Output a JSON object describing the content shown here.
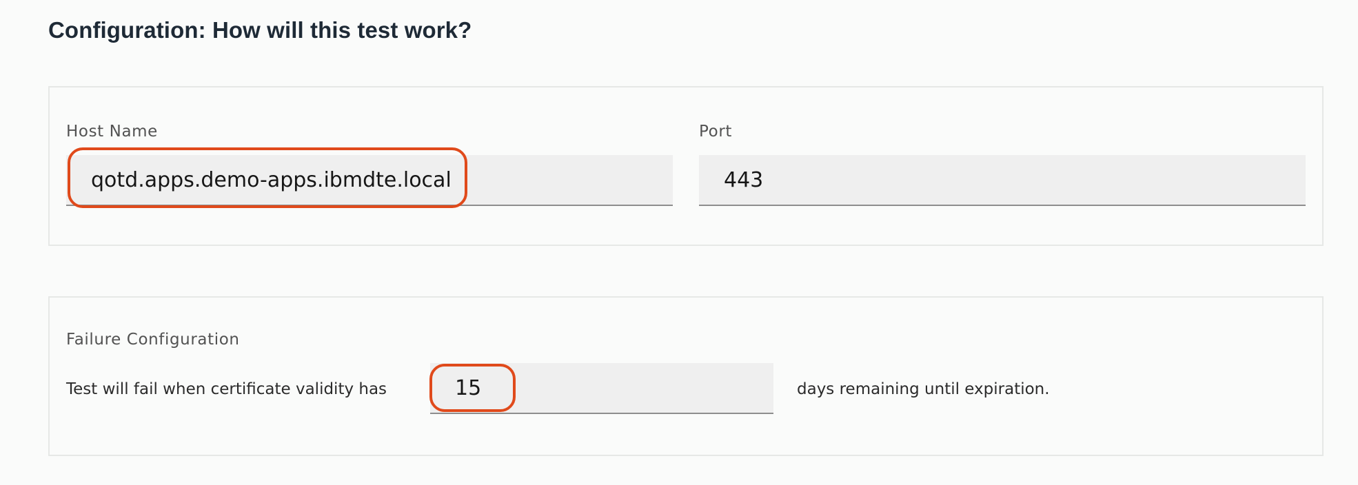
{
  "configuration": {
    "title": "Configuration: How will this test work?",
    "host_name": {
      "label": "Host Name",
      "value": "qotd.apps.demo-apps.ibmdte.local"
    },
    "port": {
      "label": "Port",
      "value": "443"
    },
    "failure": {
      "label": "Failure Configuration",
      "text_before": "Test will fail when certificate validity has",
      "days_value": "15",
      "text_after": "days remaining until expiration."
    }
  },
  "colors": {
    "highlight": "#e04a1b",
    "page_background": "#fafbfa",
    "input_background": "#efefef"
  }
}
